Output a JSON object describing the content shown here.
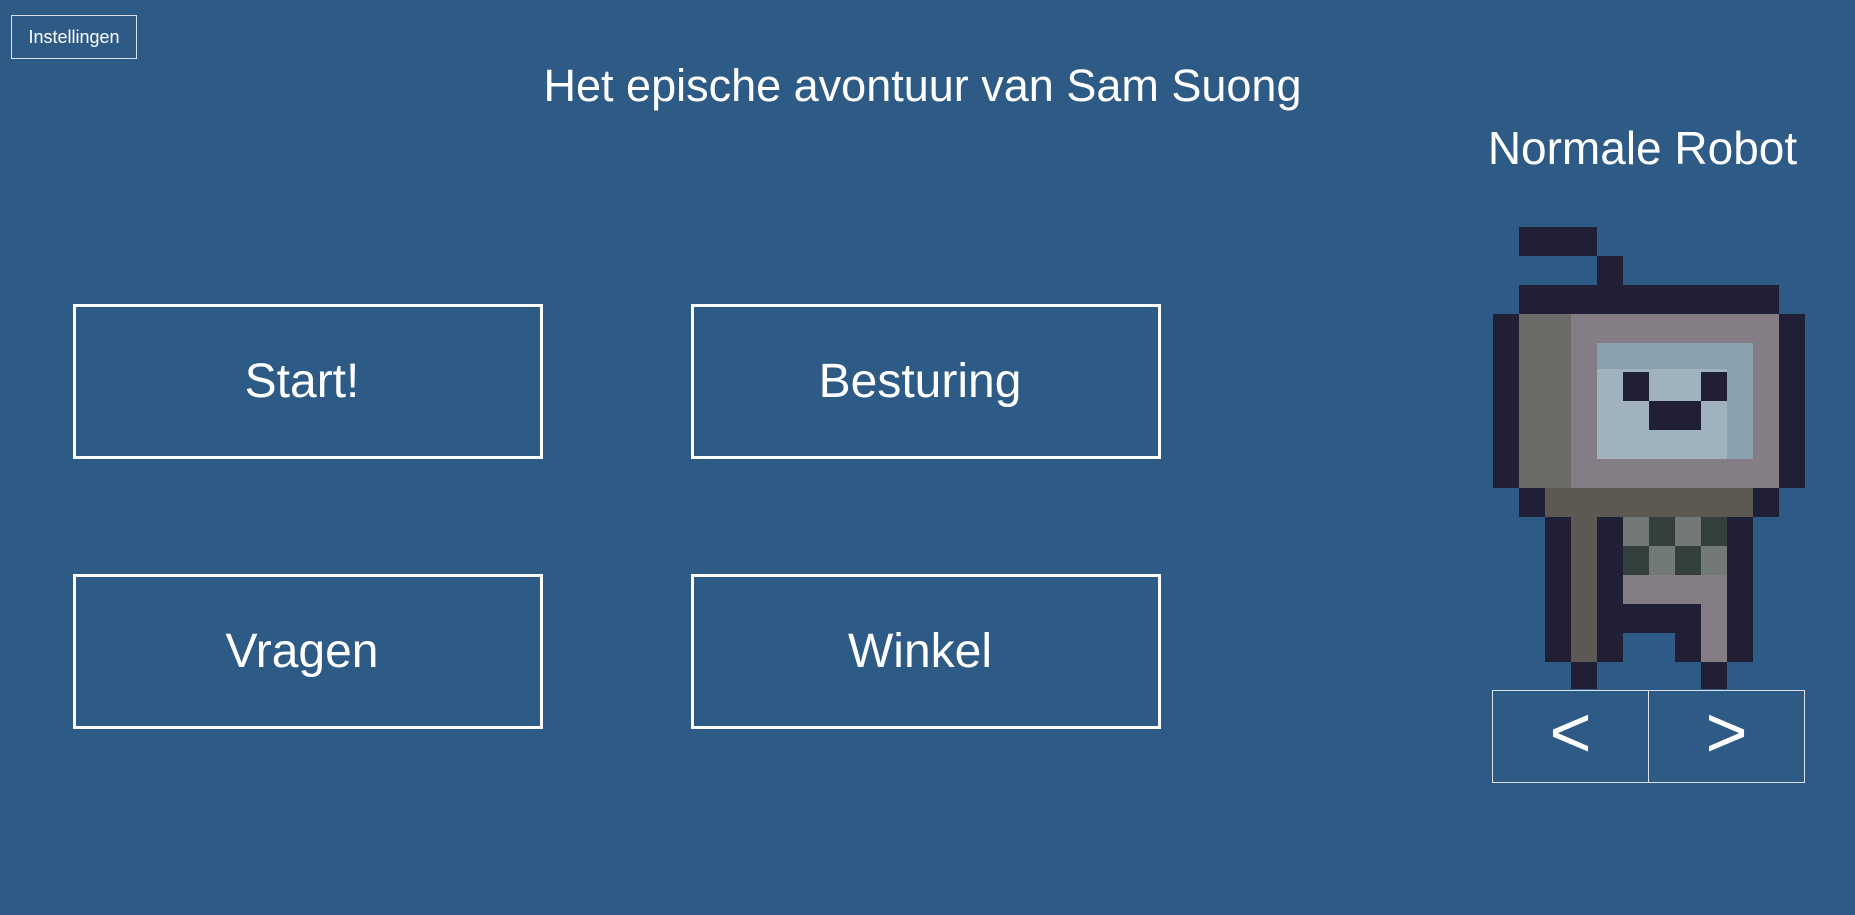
{
  "settings_label": "Instellingen",
  "title": "Het epische avontuur van Sam Suong",
  "menu": {
    "start": "Start!",
    "controls": "Besturing",
    "questions": "Vragen",
    "shop": "Winkel"
  },
  "character": {
    "name": "Normale Robot",
    "prev_label": "<",
    "next_label": ">"
  },
  "colors": {
    "background": "#2e5a86",
    "text": "#ffffff",
    "robot_outline": "#211f36",
    "robot_head": "#857d85",
    "robot_head_side": "#6b6b67",
    "robot_screen": "#9fb2bd",
    "robot_screen_shade": "#8aa0ae",
    "robot_body": "#5c5852",
    "robot_check_dark": "#34403b",
    "robot_check_light": "#737a76"
  }
}
